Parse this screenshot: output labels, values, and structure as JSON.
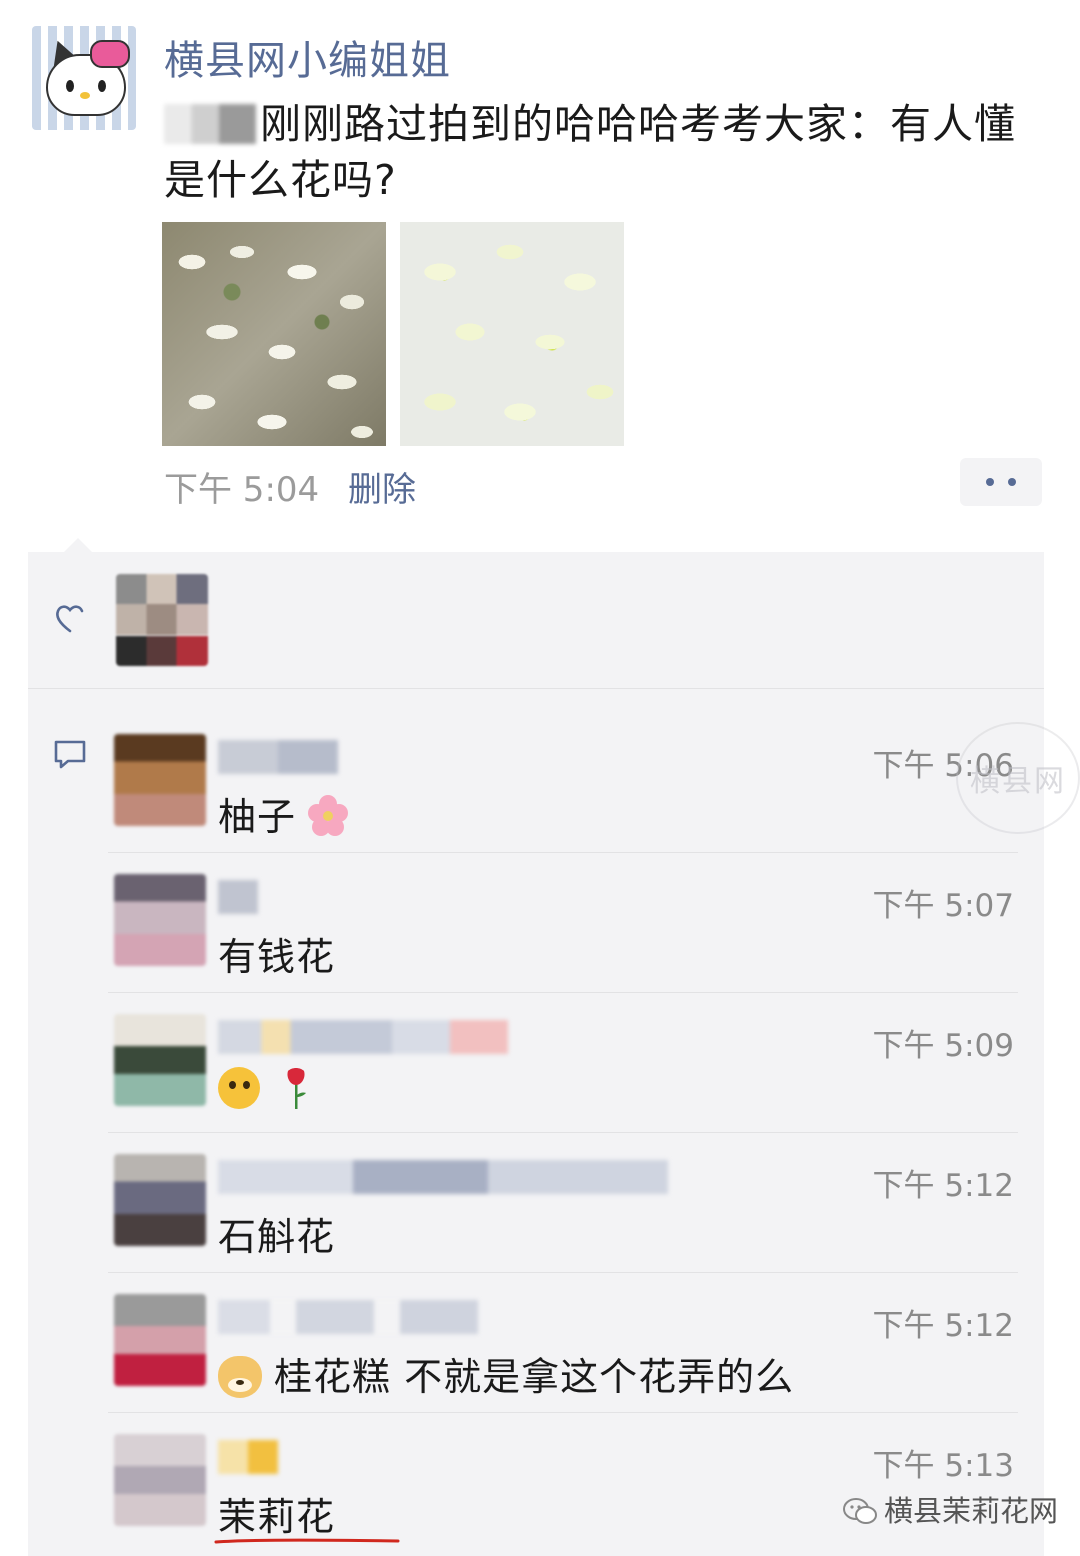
{
  "post": {
    "author": "横县网小编姐姐",
    "text": "刚刚路过拍到的哈哈哈考考大家：有人懂是什么花吗?",
    "time": "下午 5:04",
    "delete_label": "删除",
    "photos": [
      {
        "icon": "flower-photo-1"
      },
      {
        "icon": "flower-photo-2"
      }
    ]
  },
  "interactions": {
    "like_icon": "heart-outline-icon",
    "comment_icon": "speech-bubble-icon",
    "comments": [
      {
        "time": "下午 5:06",
        "text": "柚子",
        "emoji": "cherry-blossom"
      },
      {
        "time": "下午 5:07",
        "text": "有钱花"
      },
      {
        "time": "下午 5:09",
        "text": "",
        "emoji": "confused-face,rose"
      },
      {
        "time": "下午 5:12",
        "text": "石斛花"
      },
      {
        "time": "下午 5:12",
        "text": "桂花糕 不就是拿这个花弄的么",
        "emoji": "doge"
      },
      {
        "time": "下午 5:13",
        "text": "茉莉花",
        "underline_color": "#d0281e"
      }
    ]
  },
  "watermark": {
    "text": "横县网"
  },
  "footer": {
    "brand": "横县茉莉花网"
  },
  "colors": {
    "link": "#576b95",
    "panel": "#f3f3f5",
    "time": "#8a8a8a",
    "underline": "#d0281e"
  }
}
